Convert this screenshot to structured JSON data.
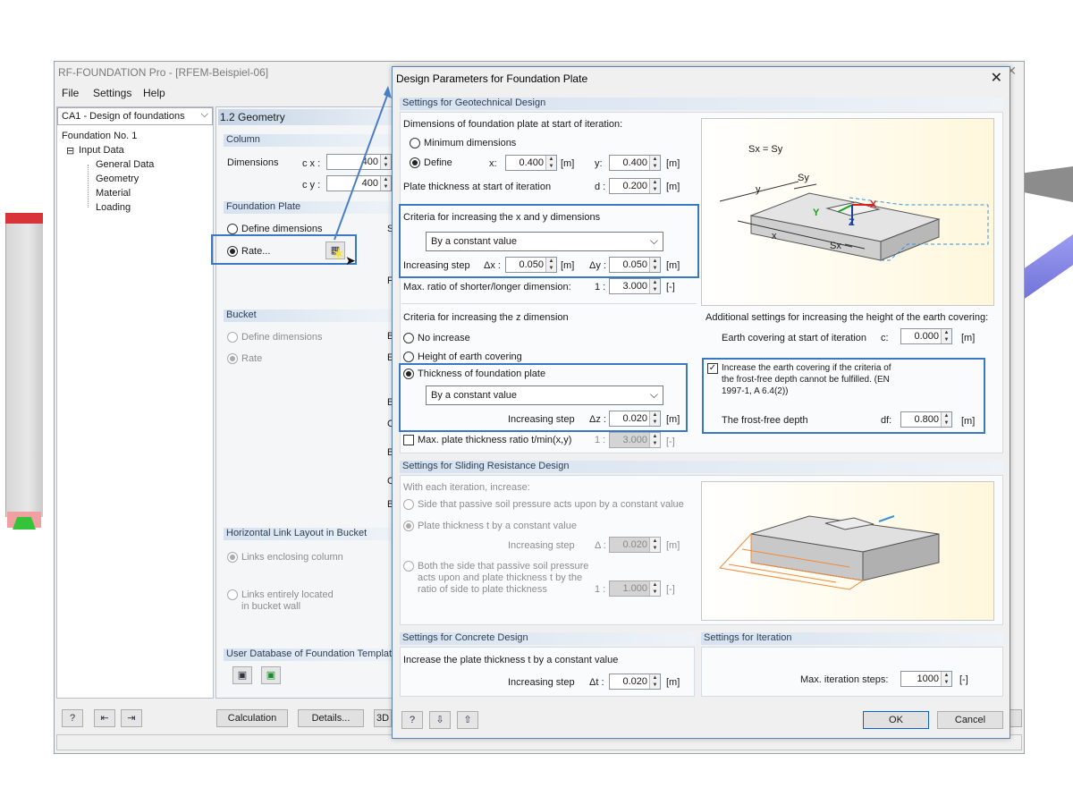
{
  "main_window": {
    "title": "RF-FOUNDATION Pro - [RFEM-Beispiel-06]",
    "menu": [
      "File",
      "Settings",
      "Help"
    ],
    "case_combo": "CA1 - Design of foundations",
    "tree": {
      "root": "Foundation No. 1",
      "group": "Input Data",
      "items": [
        "General Data",
        "Geometry",
        "Material",
        "Loading"
      ]
    },
    "page_header": "1.2 Geometry",
    "column": {
      "heading": "Column",
      "dimensions_label": "Dimensions",
      "cx_label": "c x :",
      "cy_label": "c y :",
      "cx_value": "400",
      "cy_value": "400"
    },
    "foundation_plate": {
      "heading": "Foundation Plate",
      "define_label": "Define dimensions",
      "rate_label": "Rate..."
    },
    "bucket": {
      "heading": "Bucket",
      "define_label": "Define dimensions",
      "rate_label": "Rate"
    },
    "link_layout": {
      "heading": "Horizontal Link Layout in Bucket",
      "enclosing": "Links enclosing column",
      "in_wall_1": "Links entirely located",
      "in_wall_2": "in bucket wall"
    },
    "user_db_heading": "User Database of Foundation Templates",
    "buttons": {
      "calculation": "Calculation",
      "details": "Details...",
      "three_d": "3D"
    },
    "cut_letters": [
      "S",
      "F",
      "B",
      "E",
      "B",
      "C",
      "B",
      "C",
      "B"
    ]
  },
  "dialog": {
    "title": "Design Parameters for Foundation Plate",
    "geo": {
      "heading": "Settings for Geotechnical Design",
      "dims_start": "Dimensions of foundation plate at start of iteration:",
      "min_dims": "Minimum dimensions",
      "define": "Define",
      "x_label": "x:",
      "x_value": "0.400",
      "y_label": "y:",
      "y_value": "0.400",
      "unit_m": "[m]",
      "unit_dash": "[-]",
      "thickness_label": "Plate thickness at start of iteration",
      "d_label": "d :",
      "d_value": "0.200",
      "criteria_xy": "Criteria for increasing the x and y dimensions",
      "criteria_xy_value": "By a constant value",
      "increasing_step": "Increasing step",
      "dx_label": "Δx :",
      "dx_value": "0.050",
      "dy_label": "Δy :",
      "dy_value": "0.050",
      "max_ratio_label": "Max. ratio of shorter/longer dimension:",
      "one_colon": "1 :",
      "max_ratio_value": "3.000",
      "criteria_z": "Criteria for increasing the z dimension",
      "no_increase": "No increase",
      "height_earth": "Height of earth covering",
      "thickness_plate": "Thickness of foundation plate",
      "criteria_z_value": "By a constant value",
      "dz_label": "Δz :",
      "dz_value": "0.020",
      "max_thick_ratio": "Max. plate thickness ratio t/min(x,y)",
      "max_thick_value": "3.000",
      "additional": "Additional settings for increasing the height of the earth covering:",
      "earth_start": "Earth covering at start of iteration",
      "c_label": "c:",
      "c_value": "0.000",
      "frost_chk_1": "Increase the earth covering if the criteria of",
      "frost_chk_2": "the frost-free depth cannot be fulfilled. (EN",
      "frost_chk_3": "1997-1, A 6.4(2))",
      "frost_depth": "The frost-free depth",
      "df_label": "df:",
      "df_value": "0.800",
      "fig": {
        "eq": "Sx = Sy",
        "y": "y",
        "x": "x",
        "sy": "Sy",
        "sx": "Sx",
        "ax_x": "X",
        "ax_y": "Y",
        "ax_z": "Z"
      }
    },
    "sliding": {
      "heading": "Settings for Sliding Resistance Design",
      "with_each": "With each iteration, increase:",
      "side_passive": "Side that passive soil pressure acts upon by a constant value",
      "plate_thickness": "Plate thickness t by a constant value",
      "increasing_step": "Increasing step",
      "delta_label": "Δ :",
      "delta_value": "0.020",
      "both_1": "Both the side that passive soil pressure",
      "both_2": "acts upon and plate thickness t by the",
      "both_3": "ratio of side to plate thickness",
      "ratio_value": "1.000"
    },
    "concrete": {
      "heading": "Settings for Concrete Design",
      "increase": "Increase the plate thickness t by a constant value",
      "increasing_step": "Increasing step",
      "dt_label": "Δt :",
      "dt_value": "0.020"
    },
    "iteration": {
      "heading": "Settings for Iteration",
      "max_steps": "Max. iteration steps:",
      "max_steps_value": "1000"
    },
    "ok": "OK",
    "cancel": "Cancel"
  },
  "colors": {
    "highlight": "#3b78c4",
    "section_head": "#2c3e57",
    "axis_x": "#e02020",
    "axis_y": "#18a018",
    "axis_z": "#1a3fa0",
    "sliding_wedge": "#f08a3a"
  }
}
